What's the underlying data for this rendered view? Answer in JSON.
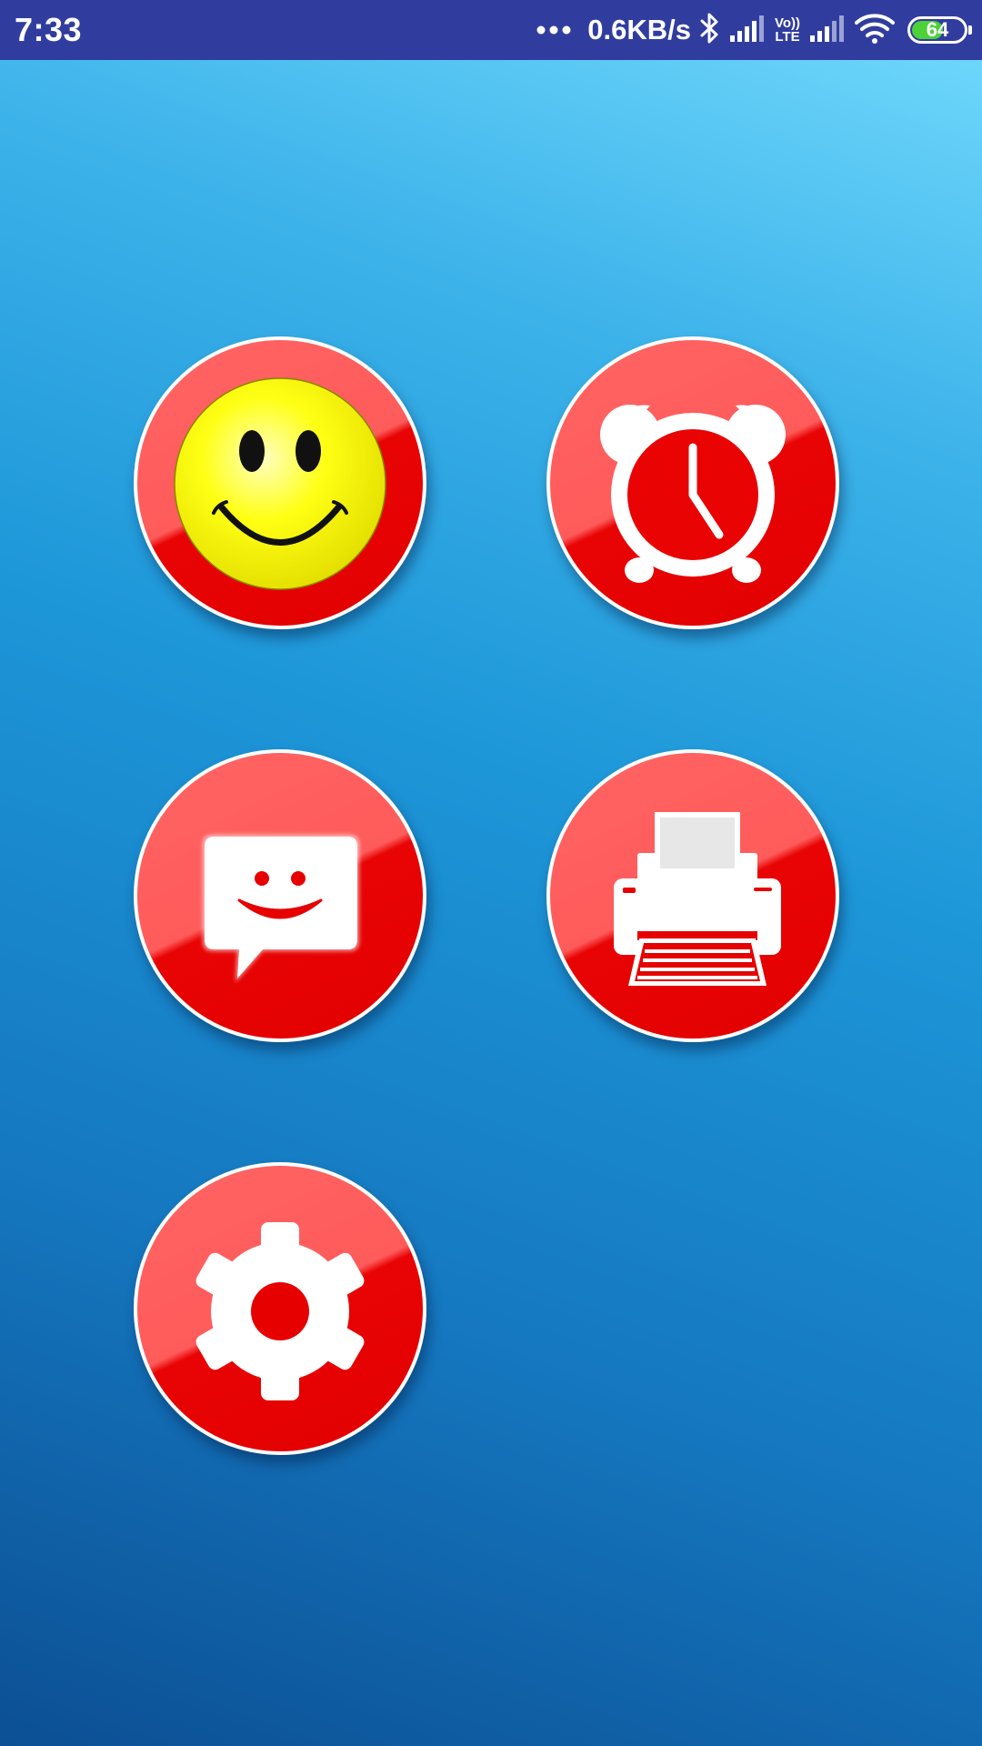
{
  "status_bar": {
    "time": "7:33",
    "network_speed": "0.6KB/s",
    "lte_top": "Vo))",
    "lte_bottom": "LTE",
    "battery_level": "64"
  },
  "colors": {
    "status_bar_bg": "#313d9e",
    "button_red": "#e30000",
    "button_highlight": "#ff6464",
    "smiley_yellow": "#ffff00",
    "battery_green": "#4cd137"
  },
  "buttons": [
    {
      "id": "smiley",
      "icon": "smiley-face-icon"
    },
    {
      "id": "alarm",
      "icon": "alarm-clock-icon"
    },
    {
      "id": "message",
      "icon": "smiley-message-icon"
    },
    {
      "id": "printer",
      "icon": "printer-icon"
    },
    {
      "id": "settings",
      "icon": "gear-icon"
    }
  ]
}
